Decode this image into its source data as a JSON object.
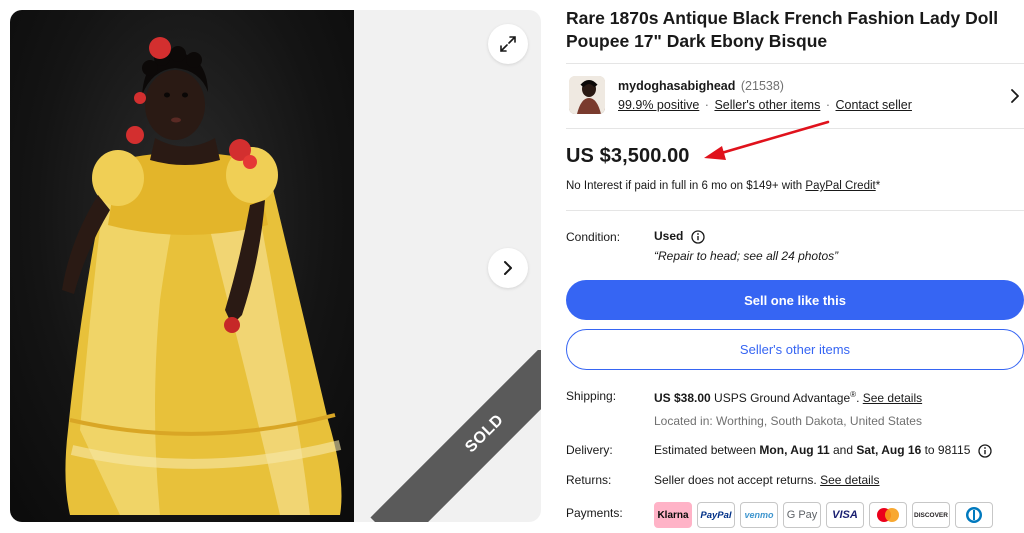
{
  "listing": {
    "title": "Rare 1870s Antique Black French Fashion Lady Doll Poupee 17\" Dark Ebony Bisque",
    "sold_badge": "SOLD"
  },
  "seller": {
    "name": "mydoghasabighead",
    "feedback_count": "(21538)",
    "positive": "99.9% positive",
    "other_items_link": "Seller's other items",
    "contact_link": "Contact seller",
    "separator": "·"
  },
  "price": {
    "amount": "US $3,500.00",
    "financing_text": "No Interest if paid in full in 6 mo on $149+ with ",
    "financing_link": "PayPal Credit",
    "financing_suffix": "*"
  },
  "condition": {
    "label": "Condition:",
    "value": "Used",
    "note": "“Repair to head; see all 24 photos”"
  },
  "actions": {
    "primary": "Sell one like this",
    "secondary": "Seller's other items"
  },
  "shipping": {
    "label": "Shipping:",
    "cost": "US $38.00",
    "service": " USPS Ground Advantage",
    "service_mark": "®",
    "separator": ".",
    "details_link": "See details",
    "location": "Located in: Worthing, South Dakota, United States"
  },
  "delivery": {
    "label": "Delivery:",
    "prefix": "Estimated between ",
    "start": "Mon, Aug 11",
    "mid": " and ",
    "end": "Sat, Aug 16",
    "suffix": " to 98115"
  },
  "returns": {
    "label": "Returns:",
    "text": "Seller does not accept returns. ",
    "details_link": "See details"
  },
  "payments": {
    "label": "Payments:",
    "methods": [
      "Klarna",
      "PayPal",
      "venmo",
      "G Pay",
      "VISA",
      "Mastercard",
      "DISCOVER",
      "Diners Club"
    ],
    "colors": {
      "klarna_bg": "#ffb3c7",
      "paypal": "#003087",
      "venmo": "#3d95ce",
      "visa": "#1a1f71",
      "discover": "#f58220"
    }
  },
  "theme": {
    "accent": "#3665f3",
    "arrow": "#e0121c",
    "sold_band": "#5a5a5a"
  }
}
